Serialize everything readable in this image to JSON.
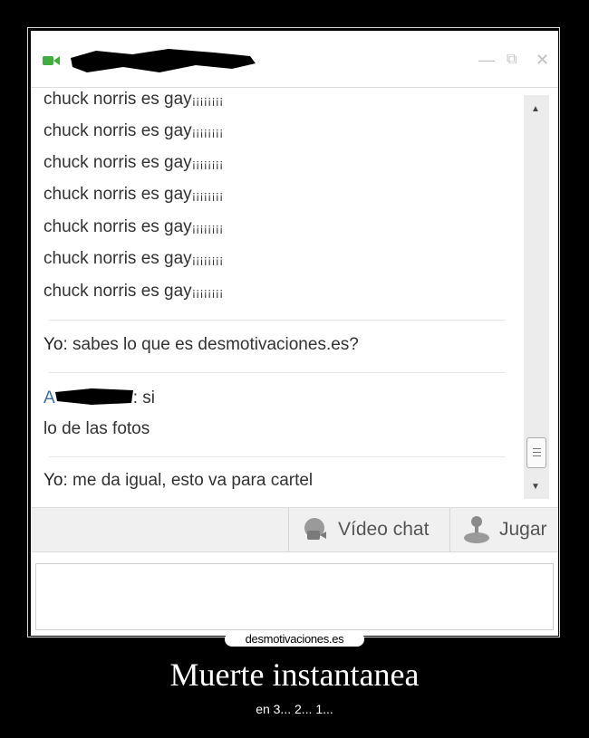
{
  "window": {
    "video_icon": "video-camera-icon",
    "controls": {
      "minimize": "—",
      "restore": "⧉",
      "close": "✕"
    }
  },
  "messages": {
    "spam": [
      {
        "text": "chuck norris es gay",
        "tail": "¡¡¡¡¡¡¡¡"
      },
      {
        "text": "chuck norris es gay",
        "tail": "¡¡¡¡¡¡¡¡"
      },
      {
        "text": "chuck norris es gay",
        "tail": "¡¡¡¡¡¡¡¡"
      },
      {
        "text": "chuck norris es gay",
        "tail": "¡¡¡¡¡¡¡¡"
      },
      {
        "text": "chuck norris es gay",
        "tail": "¡¡¡¡¡¡¡¡"
      },
      {
        "text": "chuck norris es gay",
        "tail": "¡¡¡¡¡¡¡¡"
      },
      {
        "text": "chuck norris es gay",
        "tail": "¡¡¡¡¡¡¡¡"
      }
    ],
    "me_label": "Yo",
    "me_msg_1": ": sabes lo que es desmotivaciones.es?",
    "friend_initial": "A",
    "friend_msg_1": ": si",
    "friend_msg_2": "lo de las fotos",
    "me_msg_2": ": me da igual, esto va para cartel"
  },
  "toolbar": {
    "video_chat": "Vídeo chat",
    "play": "Jugar"
  },
  "poster": {
    "brand": "desmotivaciones.es",
    "caption": "Muerte instantanea",
    "subcaption": "en 3... 2... 1..."
  }
}
